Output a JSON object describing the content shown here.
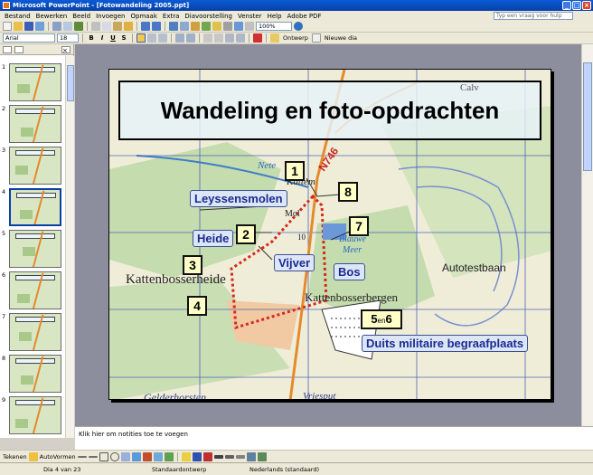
{
  "window": {
    "title": "Microsoft PowerPoint - [Fotowandeling 2005.ppt]"
  },
  "menu": {
    "items": [
      "Bestand",
      "Bewerken",
      "Beeld",
      "Invoegen",
      "Opmaak",
      "Extra",
      "Diavoorstelling",
      "Venster",
      "Help",
      "Adobe PDF"
    ],
    "help_placeholder": "Typ een vraag voor hulp"
  },
  "toolbar": {
    "zoom": "100%"
  },
  "format_toolbar": {
    "font": "Arial",
    "size": "18",
    "bold": "B",
    "italic": "I",
    "underline": "U",
    "shadow": "S",
    "design": "Ontwerp",
    "new_slide": "Nieuwe dia"
  },
  "thumbnails": {
    "numbers": [
      "1",
      "2",
      "3",
      "4",
      "5",
      "6",
      "7",
      "8",
      "9"
    ],
    "selected": 4
  },
  "slide": {
    "title": "Wandeling en foto-opdrachten",
    "labels": {
      "leyssensmolen": "Leyssensmolen",
      "heide": "Heide",
      "vijver": "Vijver",
      "bos": "Bos",
      "duits": "Duits militaire begraafplaats"
    },
    "markers": {
      "m1": "1",
      "m2": "2",
      "m3": "3",
      "m4": "4",
      "m7": "7",
      "m8": "8",
      "m56_a": "5",
      "m56_en": "en",
      "m56_b": "6"
    },
    "map_text": {
      "kattenbosserheide": "Kattenbosserheide",
      "kattenbosserbergen": "Kattenbosserbergen",
      "autotestbaan": "Autotestbaan",
      "gelderhorsten": "Gelderhorsten",
      "vriesput": "Vriesput",
      "nete": "Nete",
      "blauwe": "Blauwe",
      "meer": "Meer",
      "road": "N746",
      "kattem": "Kattem",
      "mol": "Mol",
      "ten": "10",
      "calv": "Calv"
    }
  },
  "notes": {
    "placeholder": "Klik hier om notities toe te voegen"
  },
  "drawing": {
    "draw": "Tekenen",
    "autoshapes": "AutoVormen"
  },
  "status": {
    "slide": "Dia 4 van 23",
    "design": "Standaardontwerp",
    "language": "Nederlands (standaard)"
  },
  "colors": {
    "title_bar": "#0a5bd6",
    "label_fill": "#dde6f7",
    "label_text": "#1a2c8f",
    "marker_fill": "#ffffc8",
    "route": "#d42a1c",
    "map_green": "#c5dcae"
  }
}
